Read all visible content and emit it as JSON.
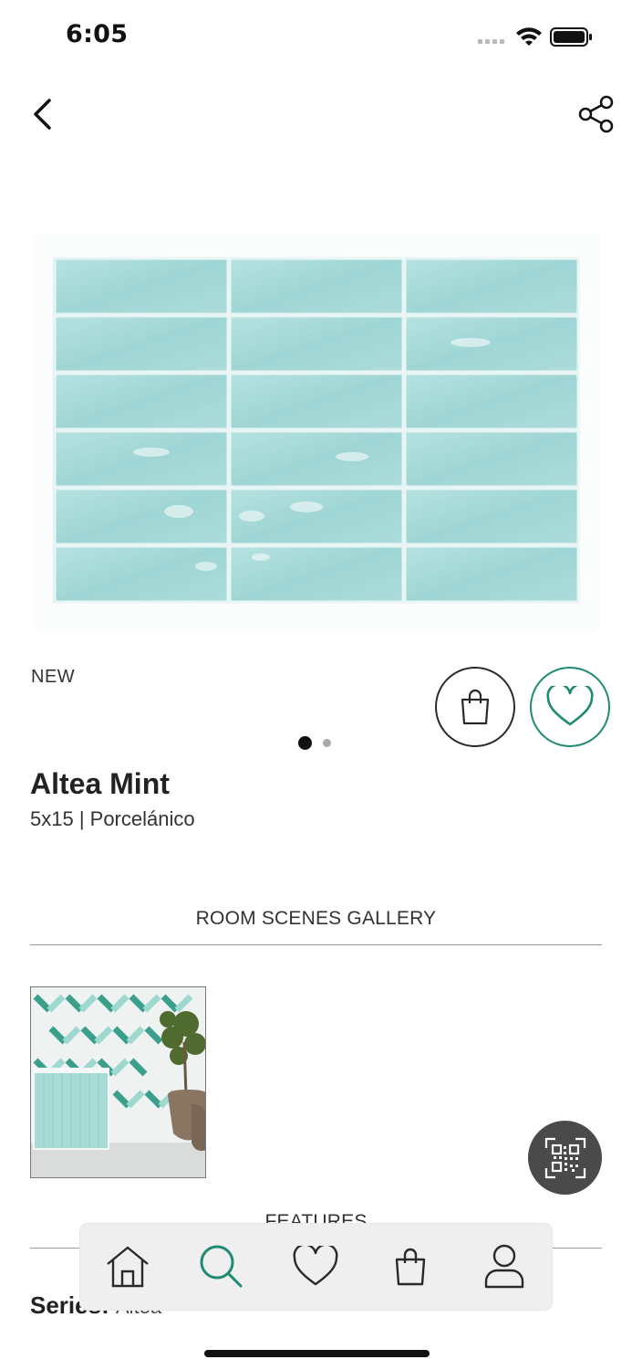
{
  "status_bar": {
    "time": "6:05"
  },
  "product": {
    "badge": "NEW",
    "name": "Altea Mint",
    "subtitle": "5x15 | Porcelánico",
    "image_count": 2,
    "active_image": 1
  },
  "sections": {
    "room_scenes_title": "ROOM SCENES GALLERY",
    "features_title": "FEATURES"
  },
  "features": {
    "series_label": "Series:",
    "series_value": "Altea"
  },
  "bottom_nav": {
    "items": [
      {
        "icon": "home-icon",
        "active": false
      },
      {
        "icon": "search-icon",
        "active": true
      },
      {
        "icon": "heart-icon",
        "active": false
      },
      {
        "icon": "bag-icon",
        "active": false
      },
      {
        "icon": "user-icon",
        "active": false
      }
    ]
  },
  "colors": {
    "accent": "#1f8a72",
    "tile": "#a9dcdc",
    "fab": "#4a4a4a"
  }
}
